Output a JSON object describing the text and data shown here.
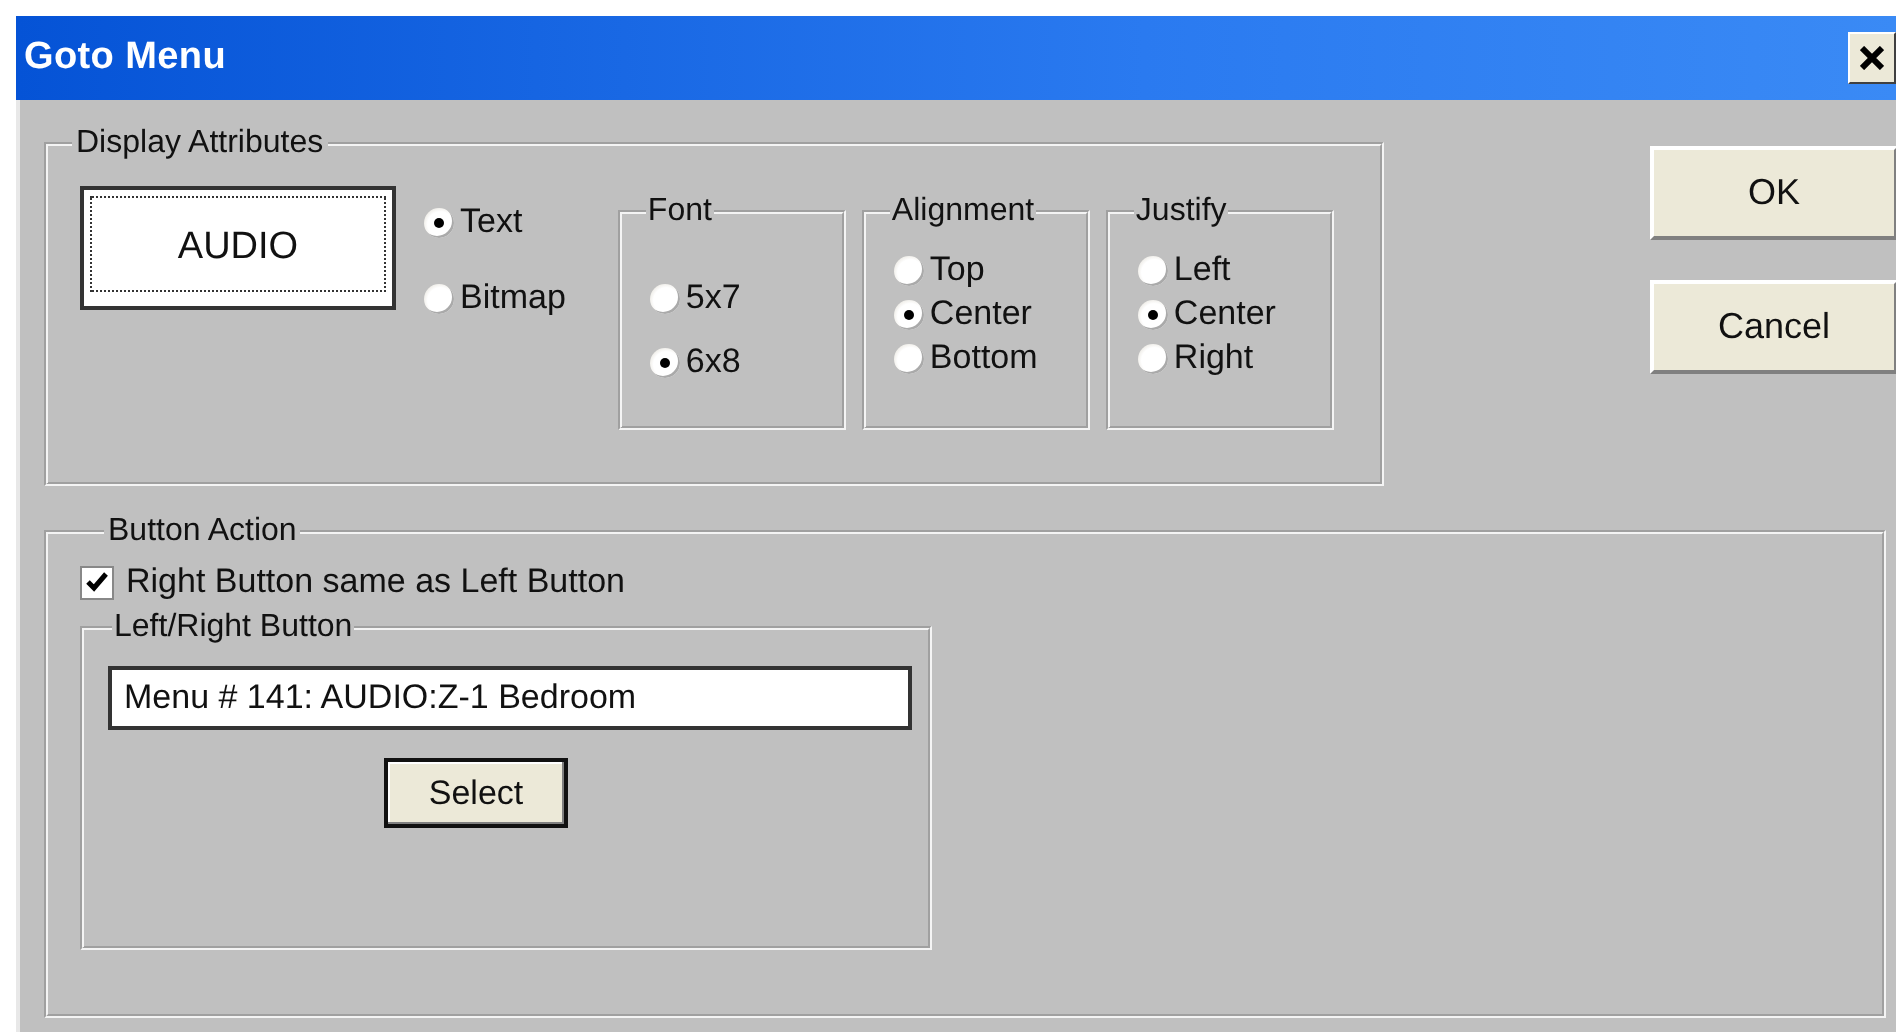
{
  "window": {
    "title": "Goto Menu"
  },
  "display_attributes": {
    "title": "Display Attributes",
    "preview": "AUDIO",
    "content_type": [
      {
        "label": "Text",
        "selected": true
      },
      {
        "label": "Bitmap",
        "selected": false
      }
    ],
    "groups": [
      {
        "title": "Font",
        "options": [
          {
            "label": "5x7",
            "selected": false
          },
          {
            "label": "6x8",
            "selected": true
          }
        ]
      },
      {
        "title": "Alignment",
        "options": [
          {
            "label": "Top",
            "selected": false
          },
          {
            "label": "Center",
            "selected": true
          },
          {
            "label": "Bottom",
            "selected": false
          }
        ]
      },
      {
        "title": "Justify",
        "options": [
          {
            "label": "Left",
            "selected": false
          },
          {
            "label": "Center",
            "selected": true
          },
          {
            "label": "Right",
            "selected": false
          }
        ]
      }
    ]
  },
  "buttons": [
    {
      "label": "OK"
    },
    {
      "label": "Cancel"
    }
  ],
  "button_action": {
    "title": "Button Action",
    "same_as_left": {
      "label": "Right Button same as Left Button",
      "checked": true
    },
    "left_right": {
      "title": "Left/Right Button",
      "value": "Menu # 141: AUDIO:Z-1 Bedroom",
      "select": "Select"
    }
  }
}
